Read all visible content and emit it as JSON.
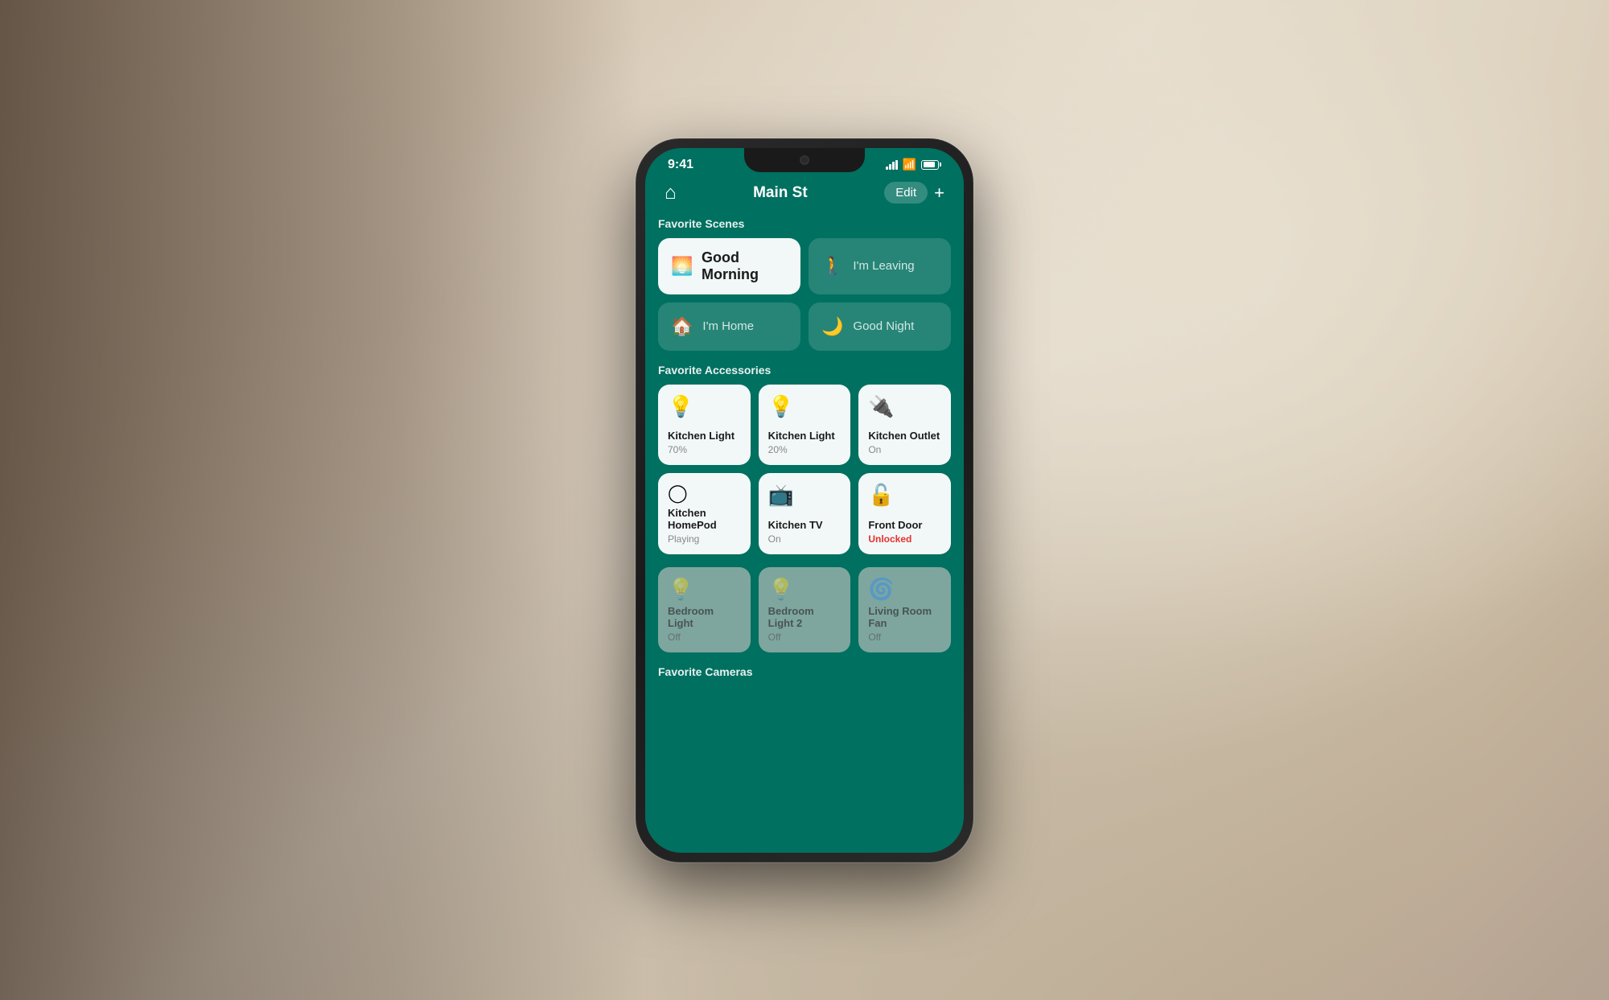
{
  "background": {
    "description": "kitchen background photo"
  },
  "phone": {
    "status_bar": {
      "time": "9:41",
      "signal": "signal",
      "wifi": "wifi",
      "battery": "battery"
    },
    "nav": {
      "title": "Main St",
      "edit_label": "Edit",
      "add_label": "+"
    },
    "sections": {
      "favorite_scenes": {
        "label": "Favorite Scenes",
        "scenes": [
          {
            "id": "good-morning",
            "icon": "🌅",
            "label": "Good Morning",
            "active": true
          },
          {
            "id": "im-leaving",
            "icon": "🚶",
            "label": "I'm Leaving",
            "active": false
          },
          {
            "id": "im-home",
            "icon": "🏠",
            "label": "I'm Home",
            "active": false
          },
          {
            "id": "good-night",
            "icon": "🌙",
            "label": "Good Night",
            "active": false
          }
        ]
      },
      "favorite_accessories": {
        "label": "Favorite Accessories",
        "accessories": [
          {
            "id": "kitchen-light-1",
            "icon": "💡",
            "name": "Kitchen Light",
            "status": "70%",
            "dim": false,
            "alert": false
          },
          {
            "id": "kitchen-light-2",
            "icon": "💡",
            "name": "Kitchen Light",
            "status": "20%",
            "dim": false,
            "alert": false
          },
          {
            "id": "kitchen-outlet",
            "icon": "🔌",
            "name": "Kitchen Outlet",
            "status": "On",
            "dim": false,
            "alert": false
          },
          {
            "id": "kitchen-homepod",
            "icon": "⬜",
            "name": "Kitchen HomePod",
            "status": "Playing",
            "dim": false,
            "alert": false
          },
          {
            "id": "kitchen-tv",
            "icon": "📺",
            "name": "Kitchen TV",
            "status": "On",
            "dim": false,
            "alert": false
          },
          {
            "id": "front-door",
            "icon": "🔓",
            "name": "Front Door",
            "status": "Unlocked",
            "dim": false,
            "alert": true
          }
        ]
      },
      "more_accessories": {
        "accessories": [
          {
            "id": "bedroom-light",
            "icon": "💡",
            "name": "Bedroom Light",
            "status": "Off",
            "dim": true,
            "alert": false
          },
          {
            "id": "bedroom-light-2",
            "icon": "💡",
            "name": "Bedroom Light 2",
            "status": "Off",
            "dim": true,
            "alert": false
          },
          {
            "id": "living-room-fan",
            "icon": "🌀",
            "name": "Living Room Fan",
            "status": "Off",
            "dim": true,
            "alert": false
          }
        ]
      },
      "favorite_cameras": {
        "label": "Favorite Cameras"
      }
    }
  }
}
